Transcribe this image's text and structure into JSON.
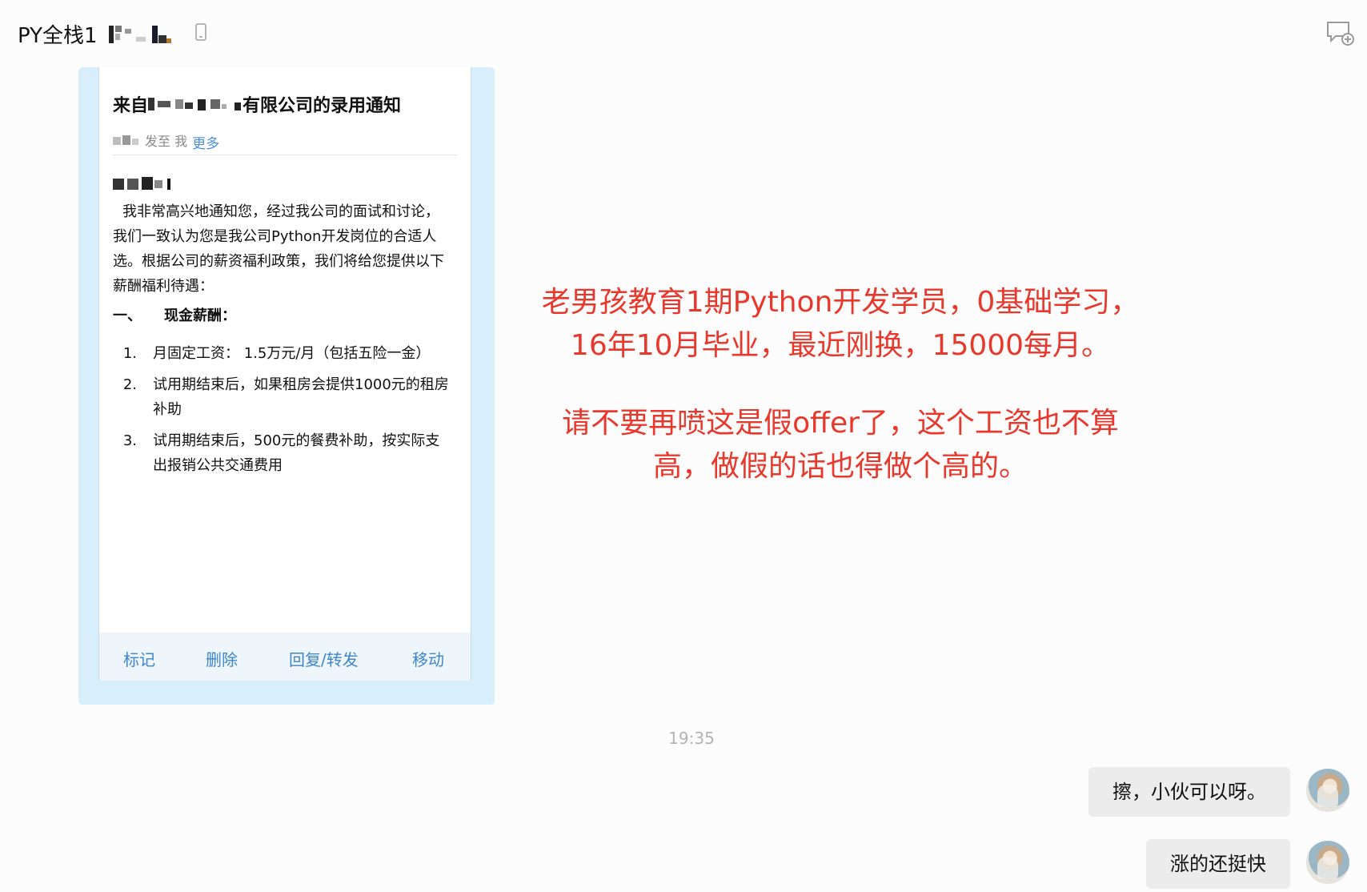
{
  "header": {
    "chat_name": "PY全栈1",
    "phone_icon": "phone-icon",
    "more_icon": "chat-add-icon"
  },
  "mail": {
    "subject_prefix": "来自",
    "subject_suffix": "有限公司的录用通知",
    "sent_to": "发至 我",
    "more_link": "更多",
    "intro": "我非常高兴地通知您，经过我公司的面试和讨论，我们一致认为您是我公司Python开发岗位的合适人选。根据公司的薪资福利政策，我们将给您提供以下薪酬福利待遇：",
    "section_num": "一、",
    "section_title": "现金薪酬：",
    "items": [
      {
        "num": "1.",
        "text": "月固定工资： 1.5万元/月（包括五险一金）"
      },
      {
        "num": "2.",
        "text": "试用期结束后，如果租房会提供1000元的租房补助"
      },
      {
        "num": "3.",
        "text": "试用期结束后，500元的餐费补助，按实际支出报销公共交通费用"
      }
    ],
    "toolbar": {
      "mark": "标记",
      "delete": "删除",
      "reply_forward": "回复/转发",
      "move": "移动"
    }
  },
  "annotation": {
    "line1": "老男孩教育1期Python开发学员，0基础学习，",
    "line2": "16年10月毕业，最近刚换，15000每月。",
    "line3": "请不要再喷这是假offer了，这个工资也不算",
    "line4": "高，做假的话也得做个高的。",
    "color": "#e8382c"
  },
  "timestamp": "19:35",
  "messages": [
    {
      "text": "擦，小伙可以呀。",
      "sender": "self"
    },
    {
      "text": "涨的还挺快",
      "sender": "self"
    }
  ]
}
